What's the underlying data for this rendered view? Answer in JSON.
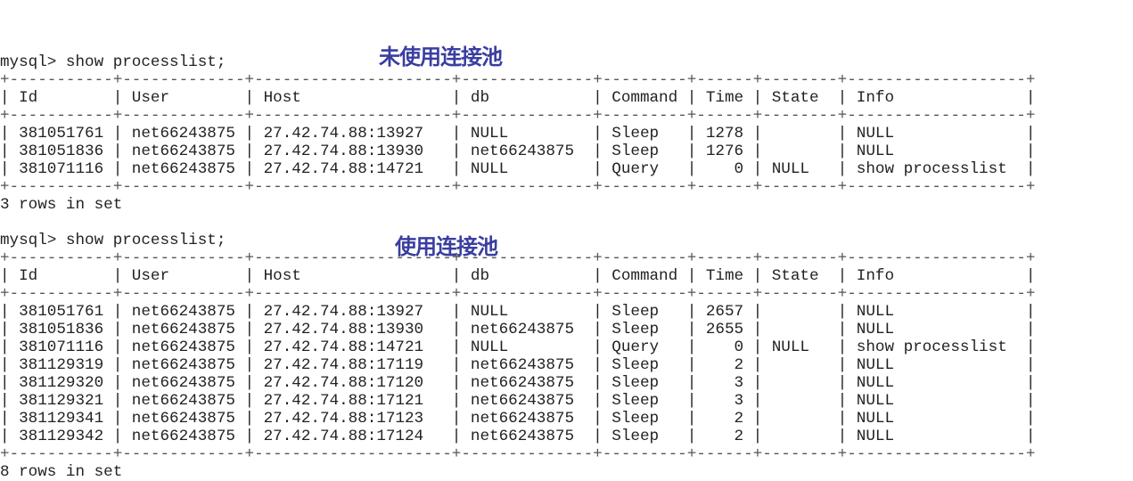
{
  "sections": [
    {
      "label": "未使用连接池",
      "prompt": "mysql> show processlist;",
      "columns": [
        "Id",
        "User",
        "Host",
        "db",
        "Command",
        "Time",
        "State",
        "Info"
      ],
      "rows": [
        [
          "381051761",
          "net66243875",
          "27.42.74.88:13927",
          "NULL",
          "Sleep",
          "1278",
          "",
          "NULL"
        ],
        [
          "381051836",
          "net66243875",
          "27.42.74.88:13930",
          "net66243875",
          "Sleep",
          "1276",
          "",
          "NULL"
        ],
        [
          "381071116",
          "net66243875",
          "27.42.74.88:14721",
          "NULL",
          "Query",
          "0",
          "NULL",
          "show processlist"
        ]
      ],
      "footer": "3 rows in set"
    },
    {
      "label": "使用连接池",
      "prompt": "mysql> show processlist;",
      "columns": [
        "Id",
        "User",
        "Host",
        "db",
        "Command",
        "Time",
        "State",
        "Info"
      ],
      "rows": [
        [
          "381051761",
          "net66243875",
          "27.42.74.88:13927",
          "NULL",
          "Sleep",
          "2657",
          "",
          "NULL"
        ],
        [
          "381051836",
          "net66243875",
          "27.42.74.88:13930",
          "net66243875",
          "Sleep",
          "2655",
          "",
          "NULL"
        ],
        [
          "381071116",
          "net66243875",
          "27.42.74.88:14721",
          "NULL",
          "Query",
          "0",
          "NULL",
          "show processlist"
        ],
        [
          "381129319",
          "net66243875",
          "27.42.74.88:17119",
          "net66243875",
          "Sleep",
          "2",
          "",
          "NULL"
        ],
        [
          "381129320",
          "net66243875",
          "27.42.74.88:17120",
          "net66243875",
          "Sleep",
          "3",
          "",
          "NULL"
        ],
        [
          "381129321",
          "net66243875",
          "27.42.74.88:17121",
          "net66243875",
          "Sleep",
          "3",
          "",
          "NULL"
        ],
        [
          "381129341",
          "net66243875",
          "27.42.74.88:17123",
          "net66243875",
          "Sleep",
          "2",
          "",
          "NULL"
        ],
        [
          "381129342",
          "net66243875",
          "27.42.74.88:17124",
          "net66243875",
          "Sleep",
          "2",
          "",
          "NULL"
        ]
      ],
      "footer": "8 rows in set"
    }
  ],
  "colors": {
    "label": "#3a3ea0",
    "text": "#222222"
  }
}
